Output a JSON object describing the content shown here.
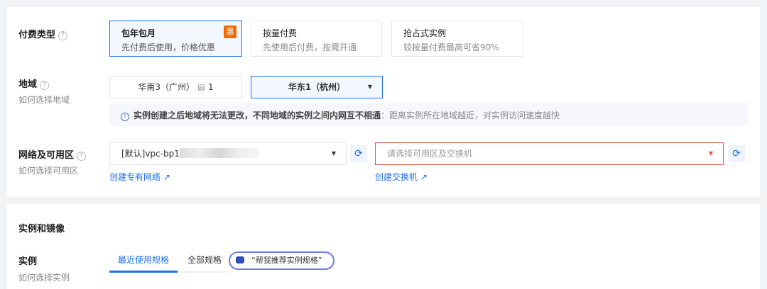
{
  "billing": {
    "label": "付费类型",
    "options": [
      {
        "title": "包年包月",
        "desc": "先付费后使用，价格优惠",
        "badge": "惠",
        "selected": true
      },
      {
        "title": "按量付费",
        "desc": "先使用后付费，按需开通",
        "selected": false
      },
      {
        "title": "抢占式实例",
        "desc": "较按量付费最高可省90%",
        "selected": false
      }
    ]
  },
  "region": {
    "label": "地域",
    "help": "如何选择地域",
    "options": [
      {
        "label": "华南3（广州）",
        "count": "1"
      },
      {
        "label": "华东1（杭州）",
        "selected": true
      }
    ],
    "notice_bold": "实例创建之后地域将无法更改，不同地域的实例之间内网互不相通",
    "notice_rest": "：距离实例所在地域越近，对实例访问速度越快"
  },
  "network": {
    "label": "网络及可用区",
    "help": "如何选择可用区",
    "vpc_value": "[默认]vpc-bp1",
    "zone_placeholder": "请选择可用区及交换机",
    "create_vpc": "创建专有网络",
    "create_vswitch": "创建交换机"
  },
  "instance": {
    "section_title": "实例和镜像",
    "label": "实例",
    "help": "如何选择实例",
    "tabs": [
      "最近使用规格",
      "全部规格"
    ],
    "assistant": "“帮我推荐实例规格”"
  }
}
